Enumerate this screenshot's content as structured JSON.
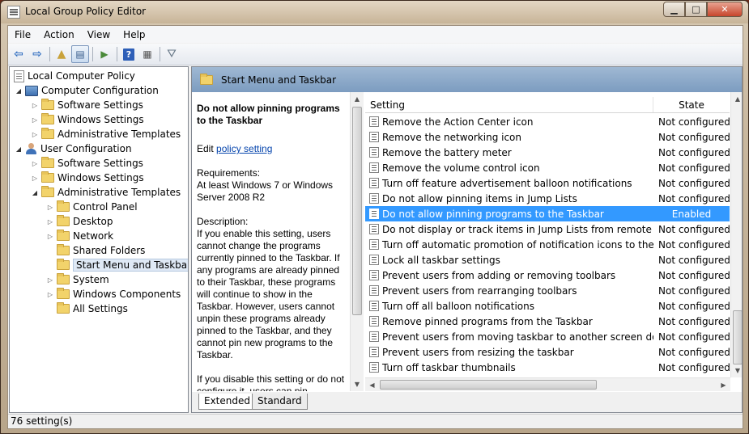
{
  "window": {
    "title": "Local Group Policy Editor"
  },
  "menu": [
    "File",
    "Action",
    "View",
    "Help"
  ],
  "tree": {
    "root": "Local Computer Policy",
    "computer_config": "Computer Configuration",
    "cc_software": "Software Settings",
    "cc_windows": "Windows Settings",
    "cc_admin": "Administrative Templates",
    "user_config": "User Configuration",
    "uc_software": "Software Settings",
    "uc_windows": "Windows Settings",
    "uc_admin": "Administrative Templates",
    "control_panel": "Control Panel",
    "desktop": "Desktop",
    "network": "Network",
    "shared_folders": "Shared Folders",
    "start_menu": "Start Menu and Taskbar",
    "system": "System",
    "windows_components": "Windows Components",
    "all_settings": "All Settings"
  },
  "pane_header": "Start Menu and Taskbar",
  "description": {
    "title": "Do not allow pinning programs to the Taskbar",
    "edit_prefix": "Edit ",
    "edit_link": "policy setting",
    "requirements_label": "Requirements:",
    "requirements_text": "At least Windows 7 or Windows Server 2008 R2",
    "description_label": "Description:",
    "description_text": "If you enable this setting, users cannot change the programs currently pinned to the Taskbar. If any programs are already pinned to their Taskbar, these programs will continue to show in the Taskbar. However, users cannot unpin these programs already pinned to the Taskbar, and they cannot pin new programs to the Taskbar.",
    "disable_text": "If you disable this setting or do not configure it, users can pin"
  },
  "columns": {
    "setting": "Setting",
    "state": "State"
  },
  "rows": [
    {
      "name": "Remove the Action Center icon",
      "state": "Not configured"
    },
    {
      "name": "Remove the networking icon",
      "state": "Not configured"
    },
    {
      "name": "Remove the battery meter",
      "state": "Not configured"
    },
    {
      "name": "Remove the volume control icon",
      "state": "Not configured"
    },
    {
      "name": "Turn off feature advertisement balloon notifications",
      "state": "Not configured"
    },
    {
      "name": "Do not allow pinning items in Jump Lists",
      "state": "Not configured"
    },
    {
      "name": "Do not allow pinning programs to the Taskbar",
      "state": "Enabled"
    },
    {
      "name": "Do not display or track items in Jump Lists from remote loca...",
      "state": "Not configured"
    },
    {
      "name": "Turn off automatic promotion of notification icons to the ta...",
      "state": "Not configured"
    },
    {
      "name": "Lock all taskbar settings",
      "state": "Not configured"
    },
    {
      "name": "Prevent users from adding or removing toolbars",
      "state": "Not configured"
    },
    {
      "name": "Prevent users from rearranging toolbars",
      "state": "Not configured"
    },
    {
      "name": "Turn off all balloon notifications",
      "state": "Not configured"
    },
    {
      "name": "Remove pinned programs from the Taskbar",
      "state": "Not configured"
    },
    {
      "name": "Prevent users from moving taskbar to another screen dock l...",
      "state": "Not configured"
    },
    {
      "name": "Prevent users from resizing the taskbar",
      "state": "Not configured"
    },
    {
      "name": "Turn off taskbar thumbnails",
      "state": "Not configured"
    }
  ],
  "tabs": {
    "extended": "Extended",
    "standard": "Standard"
  },
  "status": "76 setting(s)"
}
